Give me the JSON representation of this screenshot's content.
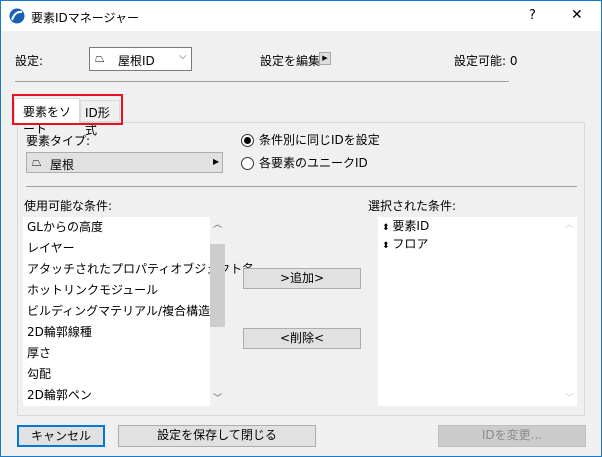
{
  "window": {
    "title": "要素IDマネージャー",
    "help": "?",
    "close": "✕"
  },
  "settings": {
    "label": "設定:",
    "value": "屋根ID",
    "edit_label": "設定を編集:",
    "available_label": "設定可能: 0"
  },
  "tabs": [
    {
      "label": "要素をソート"
    },
    {
      "label": "ID形式"
    }
  ],
  "element_type": {
    "label": "要素タイプ:",
    "value": "屋根"
  },
  "radios": [
    {
      "label": "条件別に同じIDを設定",
      "selected": true
    },
    {
      "label": "各要素のユニークID",
      "selected": false
    }
  ],
  "available": {
    "label": "使用可能な条件:",
    "items": [
      "GLからの高度",
      "レイヤー",
      "アタッチされたプロパティオブジェクト名",
      "ホットリンクモジュール",
      "ビルディングマテリアル/複合構造",
      "2D輪郭線種",
      "厚さ",
      "勾配",
      "2D輪郭ペン"
    ]
  },
  "selected": {
    "label": "選択された条件:",
    "items": [
      "要素ID",
      "フロア"
    ]
  },
  "buttons": {
    "add": ">追加>",
    "remove": "<削除<",
    "cancel": "キャンセル",
    "save_close": "設定を保存して閉じる",
    "change_id": "IDを変更..."
  }
}
